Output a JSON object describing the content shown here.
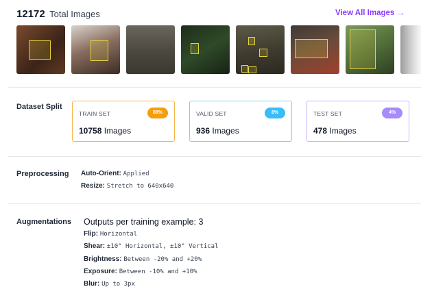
{
  "header": {
    "count": "12172",
    "total_label": "Total Images",
    "view_all_label": "View All Images →"
  },
  "colors": {
    "accent": "#8b3dff",
    "train": "#f59e0b",
    "valid": "#38bdf8",
    "test": "#a78bfa"
  },
  "dataset_split": {
    "label": "Dataset Split",
    "train": {
      "title": "TRAIN SET",
      "badge": "88%",
      "count": "10758",
      "unit": "Images"
    },
    "valid": {
      "title": "VALID SET",
      "badge": "8%",
      "count": "936",
      "unit": "Images"
    },
    "test": {
      "title": "TEST SET",
      "badge": "4%",
      "count": "478",
      "unit": "Images"
    }
  },
  "preprocessing": {
    "label": "Preprocessing",
    "items": [
      {
        "key": "Auto-Orient:",
        "value": "Applied"
      },
      {
        "key": "Resize:",
        "value": "Stretch to 640x640"
      }
    ]
  },
  "augmentations": {
    "label": "Augmentations",
    "outputs": "Outputs per training example: 3",
    "items": [
      {
        "key": "Flip:",
        "value": "Horizontal"
      },
      {
        "key": "Shear:",
        "value": "±10° Horizontal, ±10° Vertical"
      },
      {
        "key": "Brightness:",
        "value": "Between -20% and +20%"
      },
      {
        "key": "Exposure:",
        "value": "Between -10% and +10%"
      },
      {
        "key": "Blur:",
        "value": "Up to 3px"
      }
    ]
  }
}
